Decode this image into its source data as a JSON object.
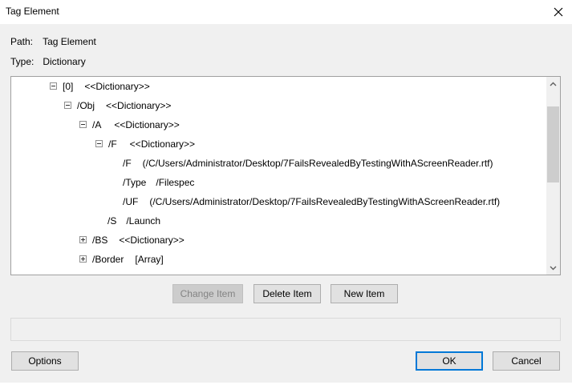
{
  "window": {
    "title": "Tag Element"
  },
  "info": {
    "path_label": "Path:",
    "path_value": "Tag Element",
    "type_label": "Type:",
    "type_value": "Dictionary"
  },
  "tree": {
    "nodes": [
      {
        "key": "[0]",
        "value": "<<Dictionary>>",
        "toggle": "minus"
      },
      {
        "key": "/Obj",
        "value": "<<Dictionary>>",
        "toggle": "minus"
      },
      {
        "key": "/A",
        "value": "<<Dictionary>>",
        "toggle": "minus"
      },
      {
        "key": "/F",
        "value": "<<Dictionary>>",
        "toggle": "minus"
      },
      {
        "key": "/F",
        "value": "(/C/Users/Administrator/Desktop/7FailsRevealedByTestingWithAScreenReader.rtf)",
        "toggle": "none"
      },
      {
        "key": "/Type",
        "value": "/Filespec",
        "toggle": "none"
      },
      {
        "key": "/UF",
        "value": "(/C/Users/Administrator/Desktop/7FailsRevealedByTestingWithAScreenReader.rtf)",
        "toggle": "none"
      },
      {
        "key": "/S",
        "value": "/Launch",
        "toggle": "none"
      },
      {
        "key": "/BS",
        "value": "<<Dictionary>>",
        "toggle": "plus"
      },
      {
        "key": "/Border",
        "value": "[Array]",
        "toggle": "plus"
      }
    ]
  },
  "buttons": {
    "change_item": "Change Item",
    "delete_item": "Delete Item",
    "new_item": "New Item",
    "options": "Options",
    "ok": "OK",
    "cancel": "Cancel"
  },
  "icons": {
    "close": "close-icon",
    "scroll_up": "chevron-up-icon",
    "scroll_down": "chevron-down-icon",
    "expand": "plus-box-icon",
    "collapse": "minus-box-icon"
  },
  "colors": {
    "accent": "#0078d7",
    "dialog_bg": "#f0f0f0",
    "tree_bg": "#ffffff"
  }
}
